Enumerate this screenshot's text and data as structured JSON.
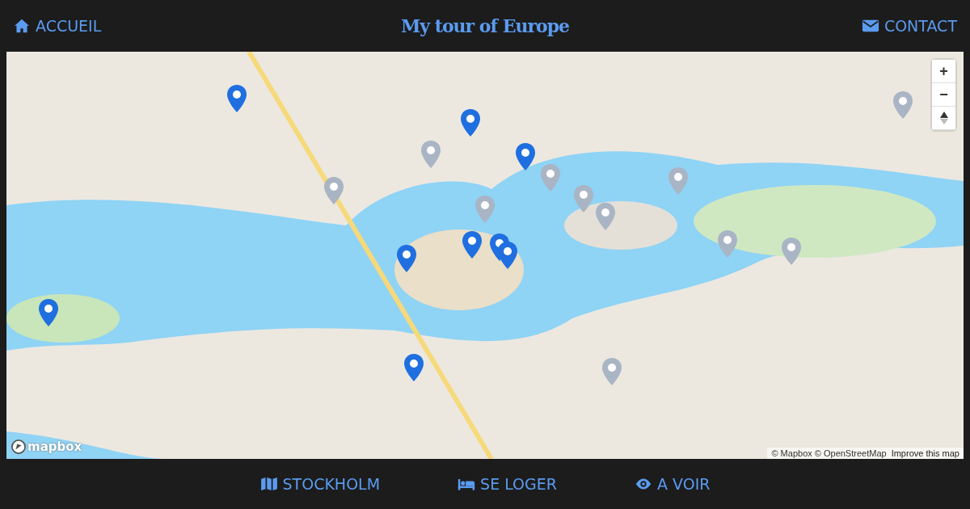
{
  "header": {
    "home_link": "ACCUEIL",
    "title": "My tour of Europe",
    "contact_link": "CONTACT"
  },
  "map": {
    "zoom_in": "+",
    "zoom_out": "−",
    "logo": "mapbox",
    "attribution": "© Mapbox © OpenStreetMap",
    "improve_link": "Improve this map",
    "pins": [
      {
        "color": "#1f6fe0"
      },
      {
        "color": "#1f6fe0"
      },
      {
        "color": "#1f6fe0"
      },
      {
        "color": "#1f6fe0"
      },
      {
        "color": "#1f6fe0"
      },
      {
        "color": "#1f6fe0"
      },
      {
        "color": "#1f6fe0"
      },
      {
        "color": "#1f6fe0"
      },
      {
        "color": "#1f6fe0"
      },
      {
        "color": "#a9b4c4"
      },
      {
        "color": "#a9b4c4"
      },
      {
        "color": "#a9b4c4"
      },
      {
        "color": "#a9b4c4"
      },
      {
        "color": "#a9b4c4"
      },
      {
        "color": "#a9b4c4"
      },
      {
        "color": "#a9b4c4"
      },
      {
        "color": "#a9b4c4"
      },
      {
        "color": "#a9b4c4"
      },
      {
        "color": "#a9b4c4"
      },
      {
        "color": "#a9b4c4"
      }
    ]
  },
  "footer_nav": [
    {
      "kind": "map",
      "label": "STOCKHOLM"
    },
    {
      "kind": "bed",
      "label": "SE LOGER"
    },
    {
      "kind": "eye",
      "label": "A VOIR"
    }
  ]
}
